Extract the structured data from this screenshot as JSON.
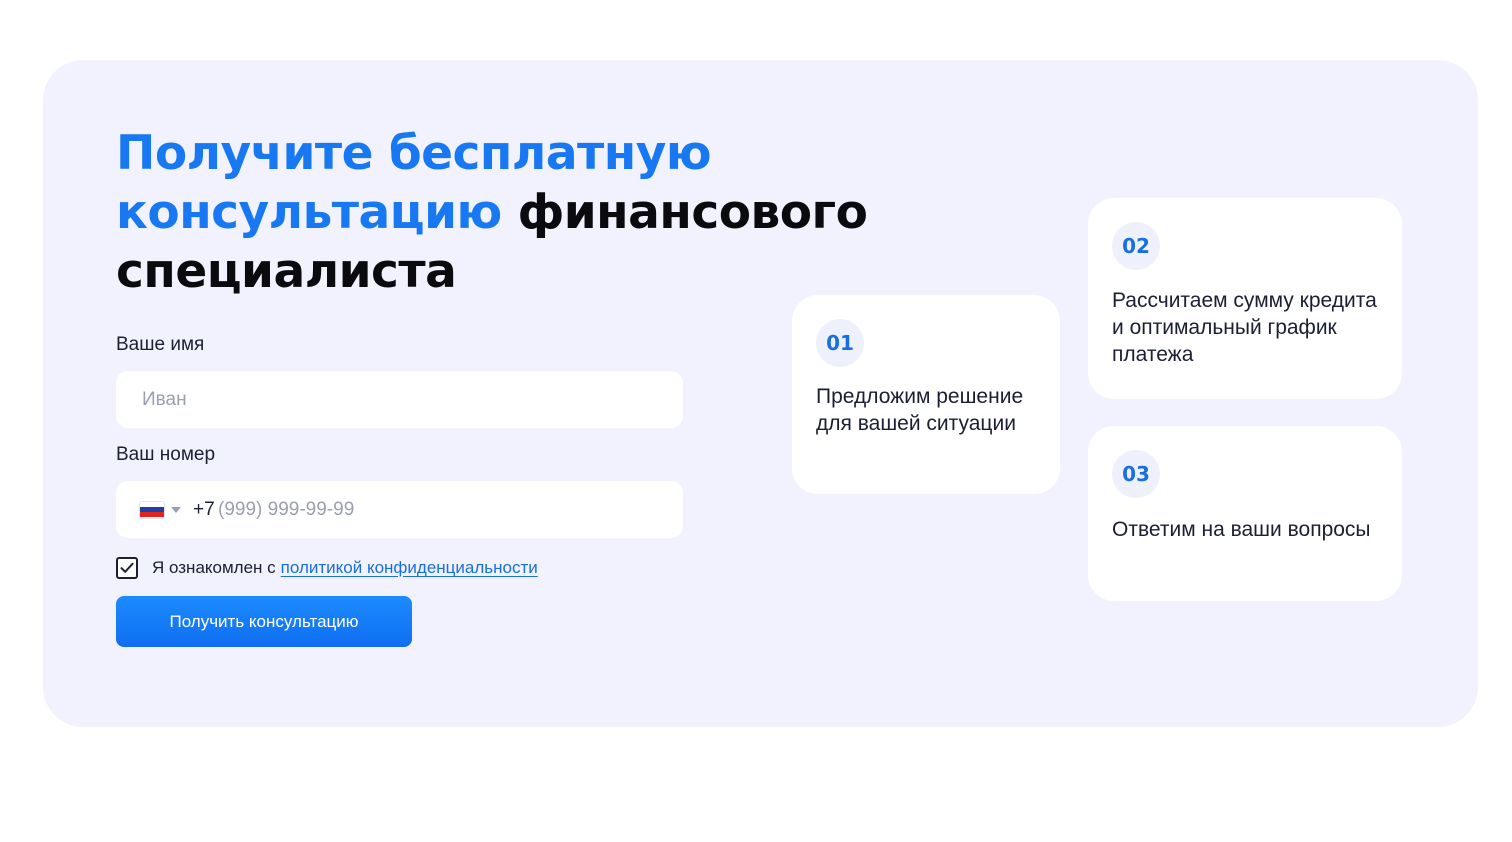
{
  "title": {
    "accent": "Получите бесплатную консультацию",
    "rest": "финансового специалиста"
  },
  "form": {
    "name_label": "Ваше имя",
    "name_placeholder": "Иван",
    "phone_label": "Ваш номер",
    "phone_country_icon": "russia-flag-icon",
    "phone_code": "+7",
    "phone_placeholder": "(999) 999-99-99",
    "consent_checked": true,
    "consent_text": "Я ознакомлен с",
    "consent_link": "политикой конфиденциальности",
    "submit_label": "Получить консультацию"
  },
  "steps": [
    {
      "number": "01",
      "text": "Предложим решение для вашей ситуации"
    },
    {
      "number": "02",
      "text": "Рассчитаем сумму кредита и оптимальный график платежа"
    },
    {
      "number": "03",
      "text": "Ответим на ваши вопросы"
    }
  ],
  "colors": {
    "accent": "#1878f2",
    "panel_background": "#f1f2fd",
    "button": "#0f6ef0"
  }
}
